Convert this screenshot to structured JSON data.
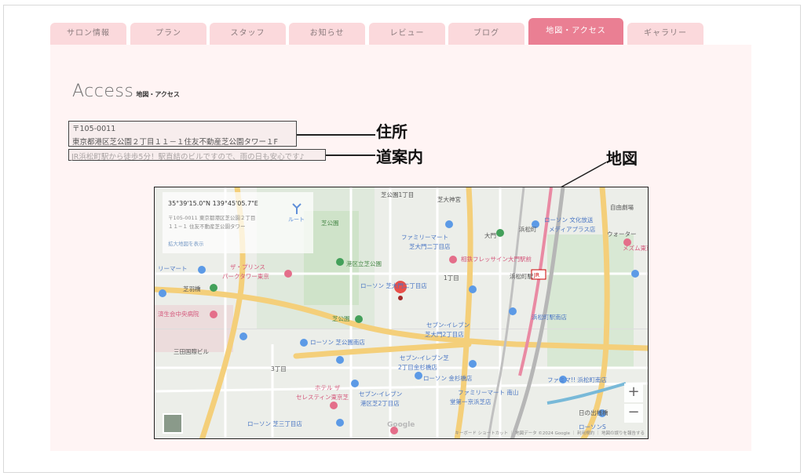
{
  "tabs": [
    {
      "label": "サロン情報"
    },
    {
      "label": "プラン"
    },
    {
      "label": "スタッフ"
    },
    {
      "label": "お知らせ"
    },
    {
      "label": "レビュー"
    },
    {
      "label": "ブログ"
    },
    {
      "label": "地図・アクセス",
      "active": true
    },
    {
      "label": "ギャラリー"
    }
  ],
  "section": {
    "title": "Access",
    "subtitle": "地図・アクセス"
  },
  "address": {
    "postal": "〒105-0011",
    "line": "東京都港区芝公園２丁目１１－１住友不動産芝公園タワー１F"
  },
  "guide": {
    "text": "JR浜松町駅から徒歩5分！駅直結のビルですので、雨の日も安心です♪"
  },
  "callouts": {
    "address": "住所",
    "guide": "道案内",
    "map": "地図"
  },
  "map": {
    "coords": "35°39'15.0\"N 139°45'05.7\"E",
    "address_line1": "〒105-0011 東京都港区芝公園２丁目",
    "address_line2": "１１−１ 住友不動産芝公園タワー",
    "route_label": "ルート",
    "enlarge_link": "拡大地図を表示",
    "zoom_in": "+",
    "zoom_out": "−",
    "google": "Google",
    "attribution": "キーボード ショートカット ｜ 地図データ ©2024 Google ｜ 利用規約 ｜ 地図の誤りを報告する",
    "labels": [
      "芝公園1丁目",
      "芝大神宮",
      "芝公園",
      "ファミリーマート",
      "芝大門二丁目店",
      "浜松町",
      "ローソン 文化放送",
      "メディアプラス店",
      "自由劇場",
      "ウォーター",
      "メズム東京",
      "大門",
      "港区立芝公園",
      "相鉄フレッサイン大門駅前",
      "浜松町駅",
      "リーマート",
      "ザ・プリンス",
      "パークタワー東京",
      "ローソン 芝大門二丁目店",
      "1丁目",
      "芝羽橋",
      "済生会中央病院",
      "芝公園",
      "セブン-イレブン",
      "芝大門2丁目店",
      "浜松町駅南店",
      "ローソン 芝公園南店",
      "セブン-イレブン芝",
      "2丁目金杉橋店",
      "三田国際ビル",
      "3丁目",
      "ローソン 金杉橋店",
      "ホテル ザ",
      "セレスティン東京芝",
      "セブン-イレブン",
      "港区芝2丁目店",
      "ファミリーマート 南山",
      "堂第一京浜芝店",
      "ローソン 芝三丁目店",
      "日の出桟橋",
      "ファミマ!! 浜松町南店",
      "ローソンS"
    ]
  }
}
